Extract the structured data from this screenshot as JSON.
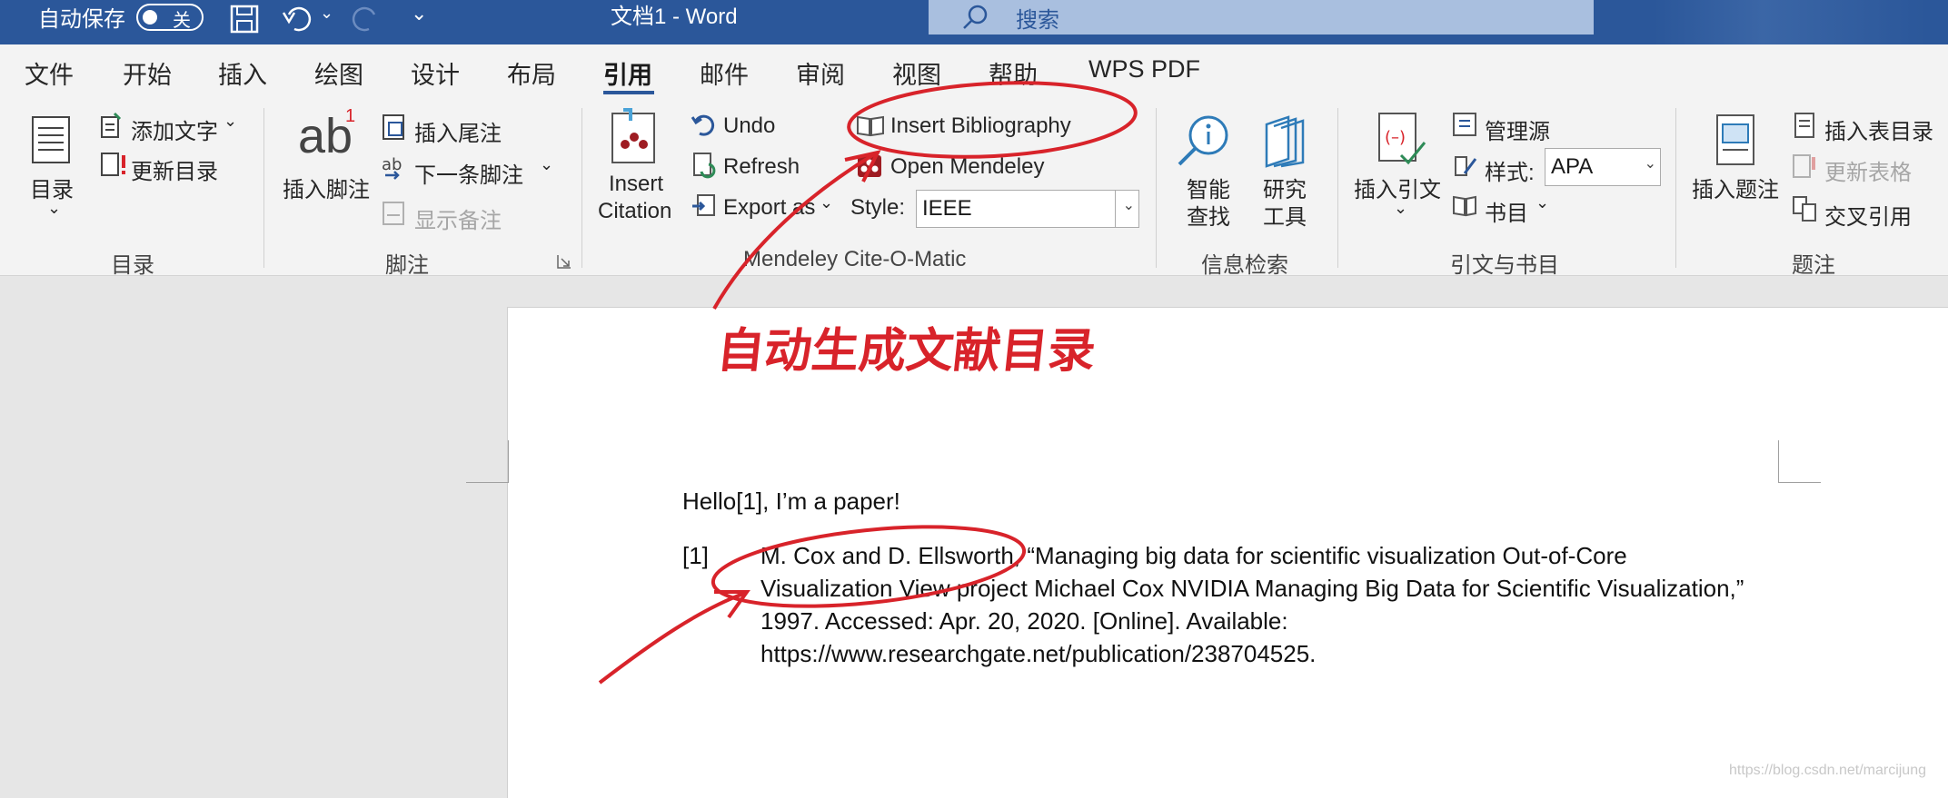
{
  "titlebar": {
    "autosave_label": "自动保存",
    "autosave_state": "关",
    "doc_title": "文档1  -  Word",
    "search_placeholder": "搜索"
  },
  "tabs": [
    {
      "label": "文件"
    },
    {
      "label": "开始"
    },
    {
      "label": "插入"
    },
    {
      "label": "绘图"
    },
    {
      "label": "设计"
    },
    {
      "label": "布局"
    },
    {
      "label": "引用",
      "active": true
    },
    {
      "label": "邮件"
    },
    {
      "label": "审阅"
    },
    {
      "label": "视图"
    },
    {
      "label": "帮助"
    },
    {
      "label": "WPS PDF"
    }
  ],
  "ribbon": {
    "toc": {
      "button": "目录",
      "add_text": "添加文字",
      "update_toc": "更新目录",
      "group": "目录"
    },
    "footnotes": {
      "insert_footnote": "插入脚注",
      "insert_endnote": "插入尾注",
      "next_footnote": "下一条脚注",
      "show_notes": "显示备注",
      "group": "脚注",
      "footnote_glyph": "ab",
      "footnote_sup": "1"
    },
    "mendeley": {
      "insert_citation_1": "Insert",
      "insert_citation_2": "Citation",
      "undo": "Undo",
      "refresh": "Refresh",
      "export_as": "Export as",
      "insert_bibliography": "Insert Bibliography",
      "open_mendeley": "Open Mendeley",
      "style_label": "Style:",
      "style_value": "IEEE",
      "group": "Mendeley Cite-O-Matic"
    },
    "research": {
      "smart_lookup_1": "智能",
      "smart_lookup_2": "查找",
      "researcher_1": "研究",
      "researcher_2": "工具",
      "group": "信息检索"
    },
    "citations": {
      "insert_citation": "插入引文",
      "manage_sources": "管理源",
      "style_label": "样式:",
      "style_value": "APA",
      "bibliography": "书目",
      "group": "引文与书目"
    },
    "captions": {
      "insert_caption": "插入题注",
      "insert_table_of_figures": "插入表目录",
      "update_table": "更新表格",
      "cross_reference": "交叉引用",
      "group": "题注"
    }
  },
  "document": {
    "line1": "Hello[1], I’m a paper!",
    "ref_num": "[1]",
    "ref_lines": [
      "M. Cox and D. Ellsworth, “Managing big data for scientific visualization Out-of-Core",
      "Visualization View project Michael Cox NVIDIA Managing Big Data for Scientific Visualization,”",
      "1997. Accessed: Apr. 20, 2020. [Online]. Available:",
      "https://www.researchgate.net/publication/238704525."
    ]
  },
  "annotation": {
    "text": "自动生成文献目录",
    "color": "#d8232a"
  },
  "watermark": "https://blog.csdn.net/marcijung",
  "colors": {
    "accent": "#2b579a",
    "ribbon_bg": "#f3f3f3",
    "annotation": "#d8232a"
  }
}
